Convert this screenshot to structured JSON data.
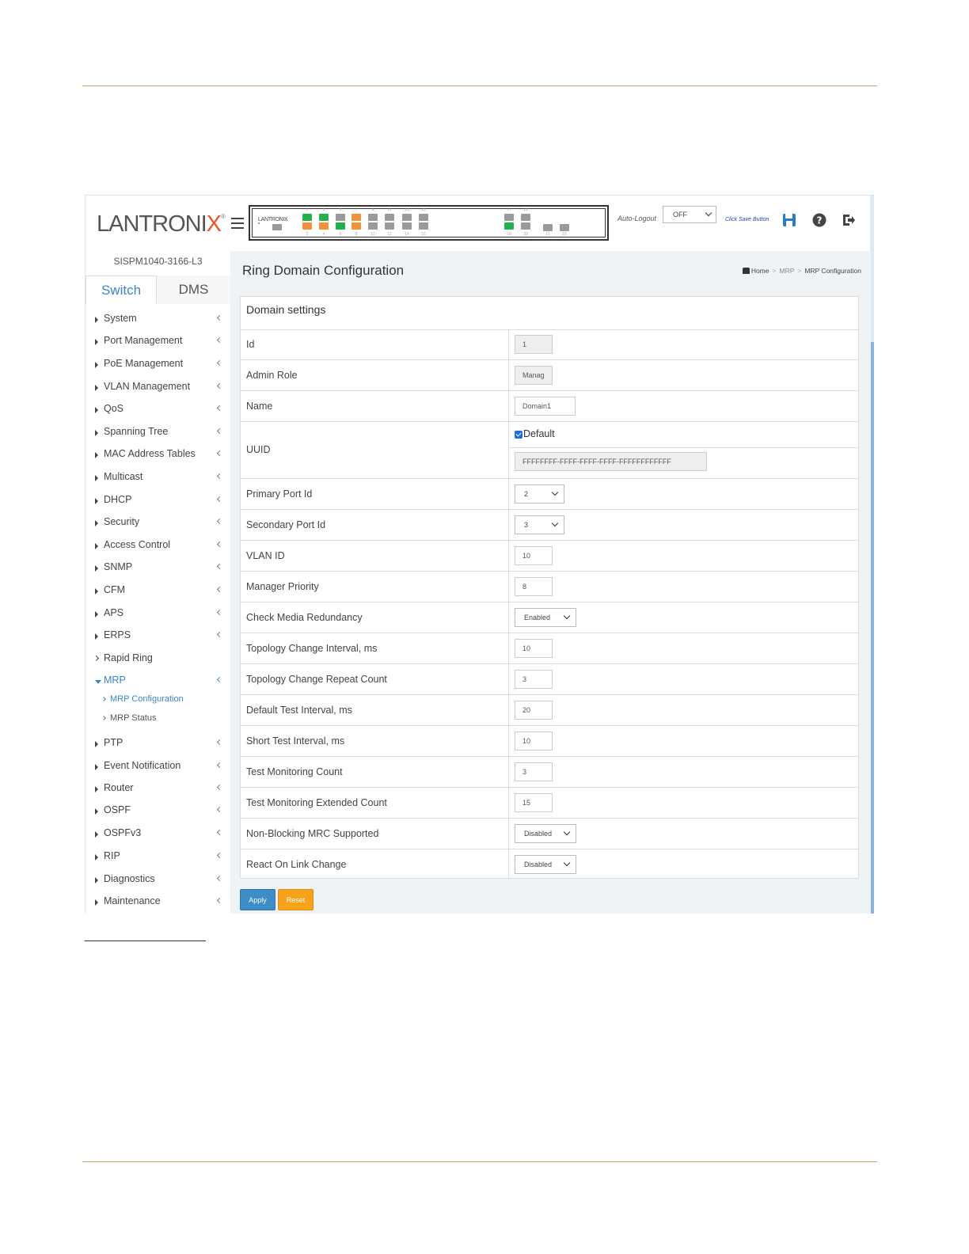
{
  "header": {
    "logo": "LANTRONIX",
    "device_brand": "LANTRONIX",
    "auto_logout_label": "Auto-Logout",
    "auto_logout_value": "OFF",
    "save_hint": "Click Save Button",
    "ports_top": [
      "1",
      "3",
      "5",
      "7",
      "9",
      "11",
      "13",
      "15",
      "17",
      "19"
    ],
    "ports_bottom": [
      "2",
      "4",
      "6",
      "8",
      "10",
      "12",
      "14",
      "16",
      "18",
      "20",
      "21",
      "22"
    ]
  },
  "sidebar": {
    "model": "SISPM1040-3166-L3",
    "tabs": [
      "Switch",
      "DMS"
    ],
    "items": [
      "System",
      "Port Management",
      "PoE Management",
      "VLAN Management",
      "QoS",
      "Spanning Tree",
      "MAC Address Tables",
      "Multicast",
      "DHCP",
      "Security",
      "Access Control",
      "SNMP",
      "CFM",
      "APS",
      "ERPS",
      "Rapid Ring",
      "MRP",
      "PTP",
      "Event Notification",
      "Router",
      "OSPF",
      "OSPFv3",
      "RIP",
      "Diagnostics",
      "Maintenance"
    ],
    "sub_items": [
      "MRP Configuration",
      "MRP Status"
    ]
  },
  "main": {
    "title": "Ring Domain Configuration",
    "breadcrumb": [
      "Home",
      "MRP",
      "MRP Configuration"
    ],
    "panel_title": "Domain settings",
    "fields": {
      "id": {
        "label": "Id",
        "value": "1"
      },
      "admin_role": {
        "label": "Admin Role",
        "value": "Manag"
      },
      "name": {
        "label": "Name",
        "value": "Domain1"
      },
      "uuid": {
        "label": "UUID",
        "default_label": "Default",
        "value": "FFFFFFFF-FFFF-FFFF-FFFF-FFFFFFFFFFFF"
      },
      "primary_port": {
        "label": "Primary Port Id",
        "value": "2"
      },
      "secondary_port": {
        "label": "Secondary Port Id",
        "value": "3"
      },
      "vlan_id": {
        "label": "VLAN ID",
        "value": "10"
      },
      "manager_priority": {
        "label": "Manager Priority",
        "value": "8"
      },
      "check_media_redundancy": {
        "label": "Check Media Redundancy",
        "value": "Enabled"
      },
      "topology_change_interval": {
        "label": "Topology Change Interval, ms",
        "value": "10"
      },
      "topology_change_repeat": {
        "label": "Topology Change Repeat Count",
        "value": "3"
      },
      "default_test_interval": {
        "label": "Default Test Interval, ms",
        "value": "20"
      },
      "short_test_interval": {
        "label": "Short Test Interval, ms",
        "value": "10"
      },
      "test_monitoring_count": {
        "label": "Test Monitoring Count",
        "value": "3"
      },
      "test_monitoring_extended": {
        "label": "Test Monitoring Extended Count",
        "value": "15"
      },
      "non_blocking_mrc": {
        "label": "Non-Blocking MRC Supported",
        "value": "Disabled"
      },
      "react_on_link_change": {
        "label": "React On Link Change",
        "value": "Disabled"
      }
    },
    "apply_label": "Apply",
    "reset_label": "Reset"
  }
}
